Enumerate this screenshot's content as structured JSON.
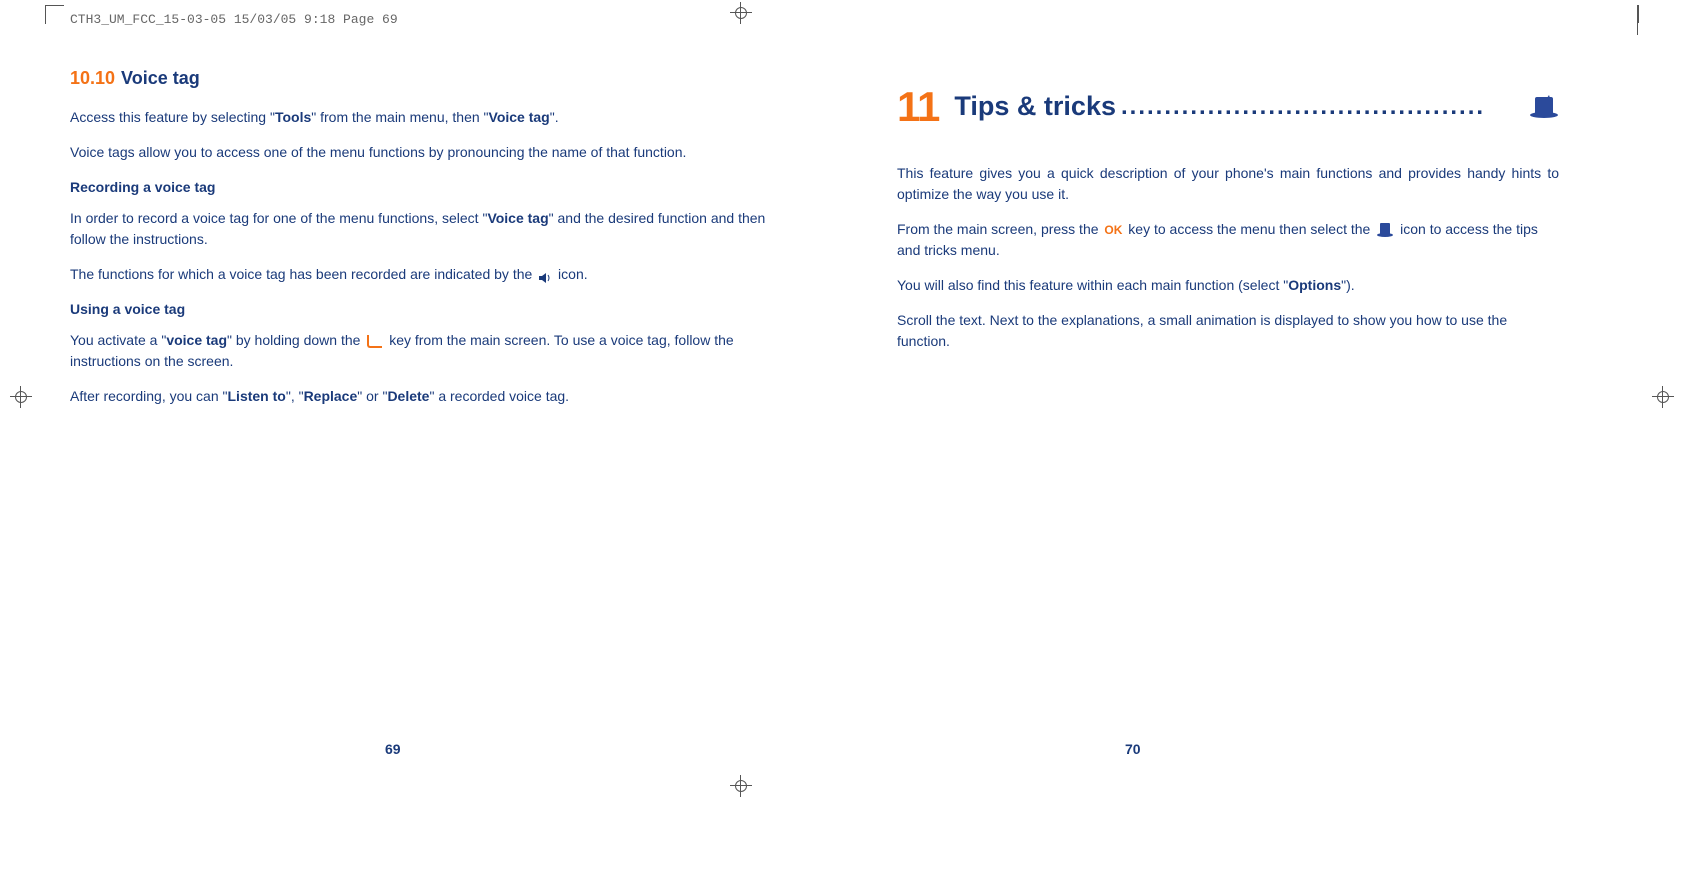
{
  "header": {
    "file_info": "CTH3_UM_FCC_15-03-05  15/03/05  9:18  Page 69"
  },
  "left_page": {
    "section_number": "10.10",
    "section_title": "Voice tag",
    "p1_a": "Access this feature by selecting \"",
    "p1_b": "Tools",
    "p1_c": "\" from the main menu, then \"",
    "p1_d": "Voice tag",
    "p1_e": "\".",
    "p2": "Voice tags allow you to access one of the menu functions by pronouncing the name of that function.",
    "sub1": "Recording a voice tag",
    "p3_a": "In order to record a voice tag for one of the menu functions, select \"",
    "p3_b": "Voice tag",
    "p3_c": "\" and the desired function and then follow the instructions.",
    "p4_a": "The functions for which a voice tag has been recorded are indicated by the ",
    "p4_b": " icon.",
    "sub2": "Using a voice tag",
    "p5_a": "You activate a \"",
    "p5_b": "voice tag",
    "p5_c": "\" by holding down the ",
    "p5_d": " key from the main screen. To use a voice tag, follow the instructions on the screen.",
    "p6_a": "After recording, you can \"",
    "p6_b": "Listen to",
    "p6_c": "\", \"",
    "p6_d": "Replace",
    "p6_e": "\" or \"",
    "p6_f": "Delete",
    "p6_g": "\" a recorded voice tag.",
    "page_number": "69"
  },
  "right_page": {
    "chapter_number": "11",
    "chapter_title": "Tips & tricks",
    "dots": "..........................................",
    "p1": "This feature gives you a quick description of your phone's main functions and provides handy hints to optimize the way you use it.",
    "p2_a": "From the main screen, press the ",
    "p2_ok": "OK",
    "p2_b": " key to access the menu then select the ",
    "p2_c": " icon to access the tips and tricks menu.",
    "p3_a": "You will also find this feature within each main function (select \"",
    "p3_b": "Options",
    "p3_c": "\").",
    "p4": "Scroll the text. Next to the explanations, a small animation is displayed to show you how to use the function.",
    "page_number": "70"
  }
}
